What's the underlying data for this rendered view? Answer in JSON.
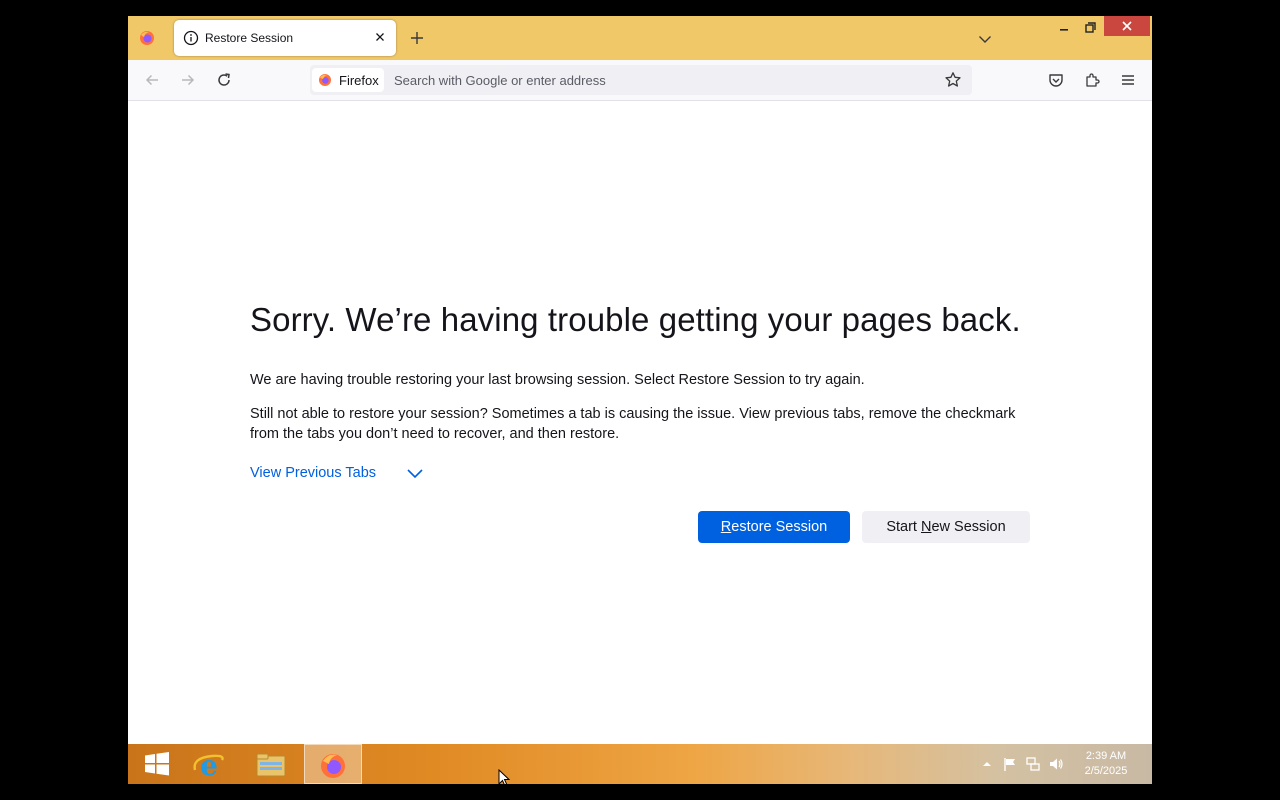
{
  "browser": {
    "tab": {
      "title": "Restore Session",
      "icon": "info-icon"
    },
    "identity_label": "Firefox",
    "url_placeholder": "Search with Google or enter address",
    "url_value": ""
  },
  "page": {
    "heading": "Sorry. We’re having trouble getting your pages back.",
    "paragraph1": "We are having trouble restoring your last browsing session. Select Restore Session to try again.",
    "paragraph2": "Still not able to restore your session? Sometimes a tab is causing the issue. View previous tabs, remove the checkmark from the tabs you don’t need to recover, and then restore.",
    "view_previous_tabs": "View Previous Tabs",
    "restore_button": {
      "accesskey": "R",
      "rest": "estore Session"
    },
    "new_session_button": {
      "before": "Start ",
      "accesskey": "N",
      "rest": "ew Session"
    }
  },
  "taskbar": {
    "time": "2:39 AM",
    "date": "2/5/2025",
    "pinned": [
      "start-button",
      "internet-explorer",
      "file-explorer",
      "firefox"
    ]
  },
  "colors": {
    "tabstrip": "#f0c868",
    "primary_button": "#0061e0",
    "link": "#0061e0",
    "window_close": "#c9473f"
  }
}
